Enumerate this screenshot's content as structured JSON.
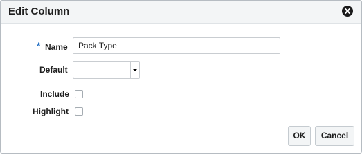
{
  "dialog": {
    "title": "Edit Column",
    "close_icon": "close-circle-icon"
  },
  "form": {
    "required_marker": "*",
    "name_label": "Name",
    "name_value": "Pack Type",
    "default_label": "Default",
    "default_value": "",
    "include_label": "Include",
    "include_checked": false,
    "highlight_label": "Highlight",
    "highlight_checked": false
  },
  "footer": {
    "ok_label": "OK",
    "cancel_label": "Cancel"
  },
  "colors": {
    "required_marker": "#1c6bc2",
    "titlebar_bg": "#f3f5f6"
  }
}
